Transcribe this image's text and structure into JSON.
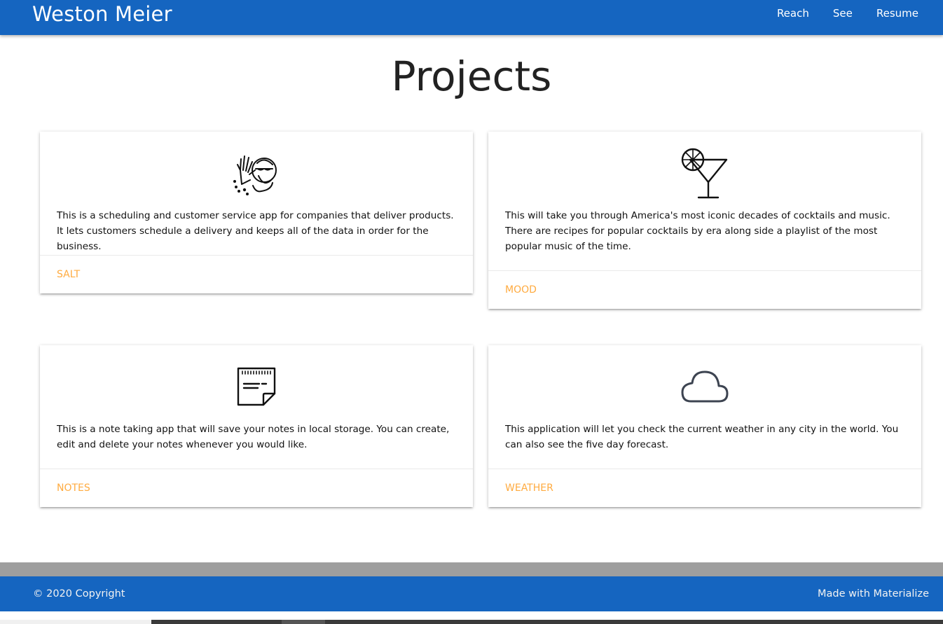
{
  "nav": {
    "brand": "Weston Meier",
    "links": [
      "Reach",
      "See",
      "Resume"
    ]
  },
  "main": {
    "title": "Projects",
    "cards": [
      {
        "icon": "zombie-hand-icon",
        "text": "This is a scheduling and customer service app for companies that deliver products. It lets customers schedule a delivery and keeps all of the data in order for the business.",
        "link": "SALT"
      },
      {
        "icon": "cocktail-glass-icon",
        "text": "This will take you through America's most iconic decades of cocktails and music. There are recipes for popular cocktails by era along side a playlist of the most popular music of the time.",
        "link": "MOOD"
      },
      {
        "icon": "notepad-icon",
        "text": "This is a note taking app that will save your notes in local storage. You can create, edit and delete your notes whenever you would like.",
        "link": "NOTES"
      },
      {
        "icon": "cloud-icon",
        "text": "This application will let you check the current weather in any city in the world. You can also see the five day forecast.",
        "link": "WEATHER"
      }
    ]
  },
  "footer": {
    "copyright": "© 2020 Copyright",
    "made_with": "Made with Materialize"
  },
  "colors": {
    "primary": "#1565c0",
    "accent_link": "#ffab40",
    "footer_band": "#9e9e9e"
  }
}
